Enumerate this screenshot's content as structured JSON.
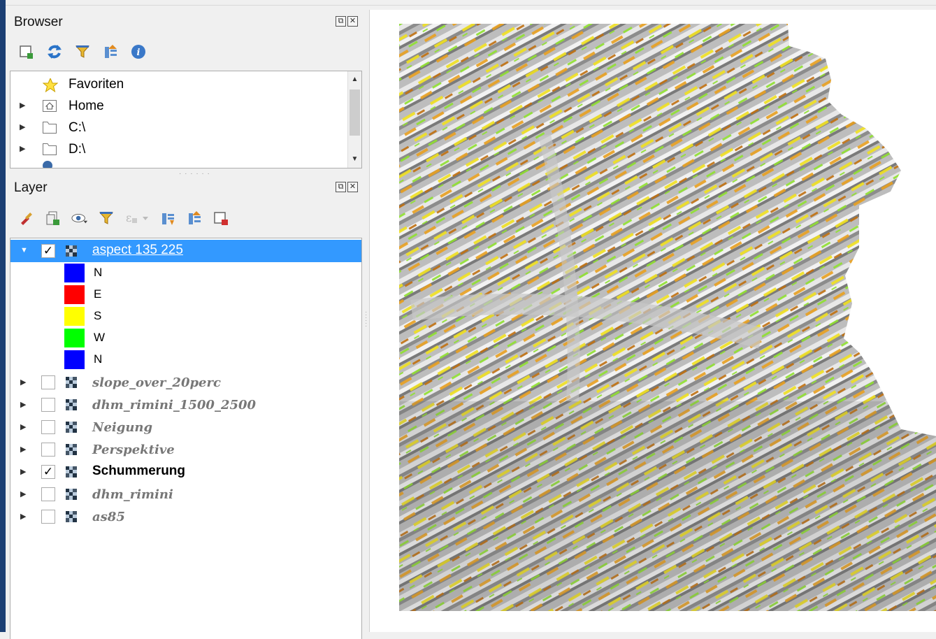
{
  "browser": {
    "title": "Browser",
    "toolbar": [
      "add-layer-icon",
      "refresh-icon",
      "filter-icon",
      "collapse-all-icon",
      "info-icon"
    ],
    "items": [
      {
        "label": "Favoriten",
        "icon": "star-icon",
        "expandable": false
      },
      {
        "label": "Home",
        "icon": "home-folder-icon",
        "expandable": true
      },
      {
        "label": "C:\\",
        "icon": "folder-icon",
        "expandable": true
      },
      {
        "label": "D:\\",
        "icon": "folder-icon",
        "expandable": true
      }
    ]
  },
  "layers": {
    "title": "Layer",
    "toolbar": [
      "style-icon",
      "add-group-icon",
      "visibility-icon",
      "filter-icon",
      "expression-filter-icon",
      "expand-all-icon",
      "collapse-all-icon",
      "remove-layer-icon"
    ],
    "active": {
      "name": "aspect 135 225",
      "checked": true,
      "legend": [
        {
          "label": "N",
          "color": "#0000ff"
        },
        {
          "label": "E",
          "color": "#ff0000"
        },
        {
          "label": "S",
          "color": "#ffff00"
        },
        {
          "label": "W",
          "color": "#00ff00"
        },
        {
          "label": "N",
          "color": "#0000ff"
        }
      ]
    },
    "items": [
      {
        "name": "slope_over_20perc",
        "checked": false
      },
      {
        "name": "dhm_rimini_1500_2500",
        "checked": false
      },
      {
        "name": "Neigung",
        "checked": false
      },
      {
        "name": "Perspektive",
        "checked": false
      },
      {
        "name": "Schummerung",
        "checked": true
      },
      {
        "name": "dhm_rimini",
        "checked": false
      },
      {
        "name": "as85",
        "checked": false
      }
    ]
  },
  "colors": {
    "selection": "#3399ff",
    "hillshade": "#b8b8b8",
    "aspect_south": "#e8a020",
    "aspect_west": "#8fe030",
    "aspect_yellow": "#f0e020"
  }
}
